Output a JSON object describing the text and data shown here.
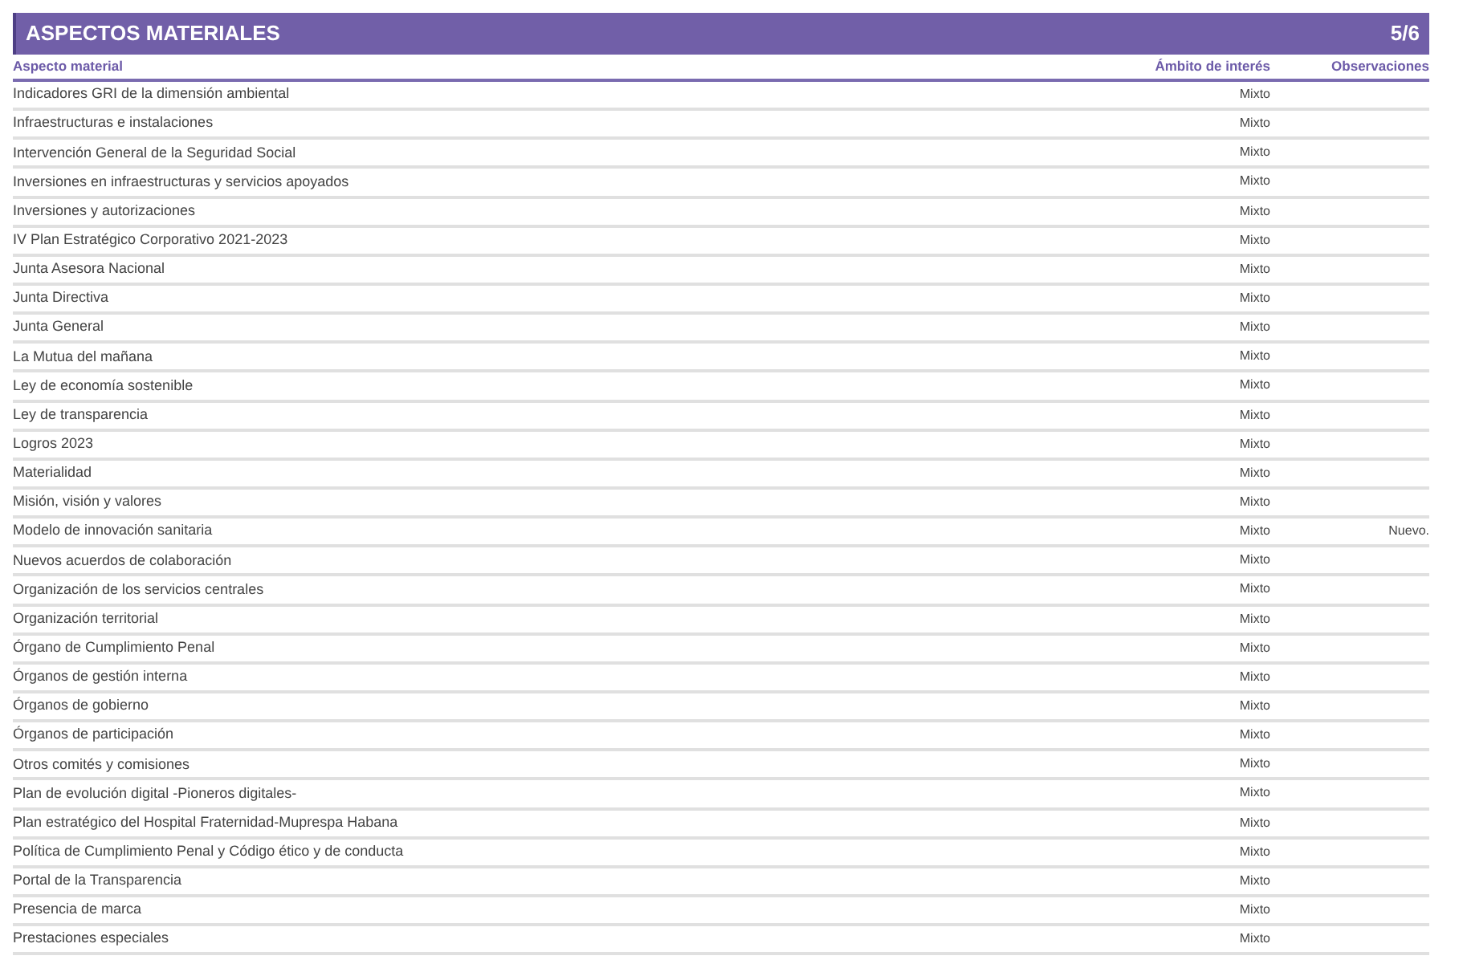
{
  "title": "ASPECTOS MATERIALES",
  "page": "5/6",
  "columns": [
    "Aspecto material",
    "Ámbito de interés",
    "Observaciones"
  ],
  "rows": [
    {
      "aspect": "Indicadores GRI de la dimensión ambiental",
      "scope": "Mixto"
    },
    {
      "aspect": "Infraestructuras e instalaciones",
      "scope": "Mixto"
    },
    {
      "aspect": "Intervención General de la Seguridad Social",
      "scope": "Mixto"
    },
    {
      "aspect": "Inversiones en infraestructuras y servicios apoyados",
      "scope": "Mixto"
    },
    {
      "aspect": "Inversiones y autorizaciones",
      "scope": "Mixto"
    },
    {
      "aspect": "IV Plan Estratégico Corporativo 2021-2023",
      "scope": "Mixto"
    },
    {
      "aspect": "Junta Asesora Nacional",
      "scope": "Mixto"
    },
    {
      "aspect": "Junta Directiva",
      "scope": "Mixto"
    },
    {
      "aspect": "Junta General",
      "scope": "Mixto"
    },
    {
      "aspect": "La Mutua del mañana",
      "scope": "Mixto"
    },
    {
      "aspect": "Ley de economía sostenible",
      "scope": "Mixto"
    },
    {
      "aspect": "Ley de transparencia",
      "scope": "Mixto"
    },
    {
      "aspect": "Logros 2023",
      "scope": "Mixto"
    },
    {
      "aspect": "Materialidad",
      "scope": "Mixto"
    },
    {
      "aspect": "Misión, visión y valores",
      "scope": "Mixto"
    },
    {
      "aspect": "Modelo de innovación sanitaria",
      "scope": "Mixto",
      "note": "Nuevo."
    },
    {
      "aspect": "Nuevos acuerdos de colaboración",
      "scope": "Mixto"
    },
    {
      "aspect": "Organización de los servicios centrales",
      "scope": "Mixto"
    },
    {
      "aspect": "Organización territorial",
      "scope": "Mixto"
    },
    {
      "aspect": "Órgano de Cumplimiento Penal",
      "scope": "Mixto"
    },
    {
      "aspect": "Órganos de gestión interna",
      "scope": "Mixto"
    },
    {
      "aspect": "Órganos de gobierno",
      "scope": "Mixto"
    },
    {
      "aspect": "Órganos de participación",
      "scope": "Mixto"
    },
    {
      "aspect": "Otros comités y comisiones",
      "scope": "Mixto"
    },
    {
      "aspect": "Plan de evolución digital -Pioneros digitales-",
      "scope": "Mixto"
    },
    {
      "aspect": "Plan estratégico del Hospital Fraternidad-Muprespa Habana",
      "scope": "Mixto"
    },
    {
      "aspect": "Política de Cumplimiento Penal y Código ético y de conducta",
      "scope": "Mixto"
    },
    {
      "aspect": "Portal de la Transparencia",
      "scope": "Mixto"
    },
    {
      "aspect": "Presencia de marca",
      "scope": "Mixto"
    },
    {
      "aspect": "Prestaciones especiales",
      "scope": "Mixto"
    }
  ]
}
